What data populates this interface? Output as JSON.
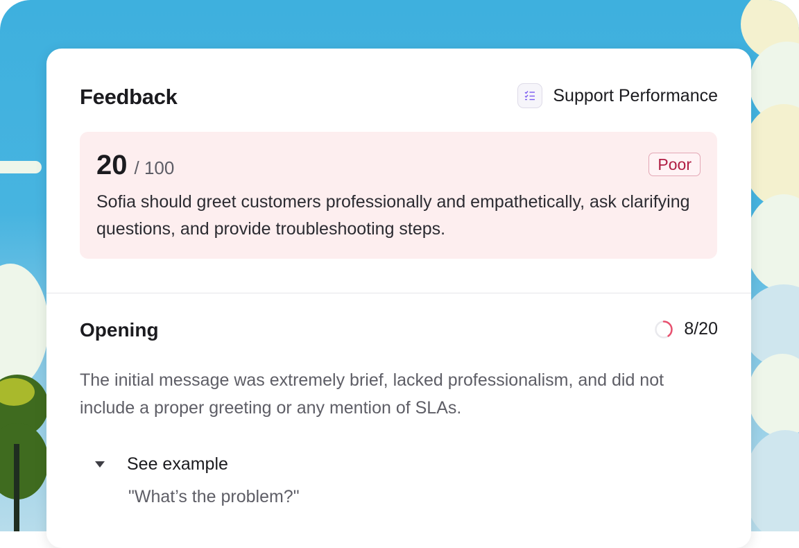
{
  "colors": {
    "poor": "#b01e44",
    "score_box_bg": "#fdeeef",
    "progress_arc": "#e8516f",
    "category_icon": "#7a5af0"
  },
  "feedback": {
    "title": "Feedback",
    "category": {
      "icon": "checklist-icon",
      "label": "Support Performance"
    }
  },
  "score": {
    "value": "20",
    "max": "/ 100",
    "rating": "Poor",
    "summary": "Sofia should greet customers professionally and empathetically, ask clarifying questions, and provide troubleshooting steps."
  },
  "section": {
    "title": "Opening",
    "score_text": "8/20",
    "progress_fraction": 0.4,
    "description": "The initial message was extremely brief, lacked professionalism, and did not include a proper greeting or any mention of SLAs.",
    "example": {
      "toggle_label": "See example",
      "expanded": true,
      "quote": "\"What’s the problem?\""
    }
  }
}
